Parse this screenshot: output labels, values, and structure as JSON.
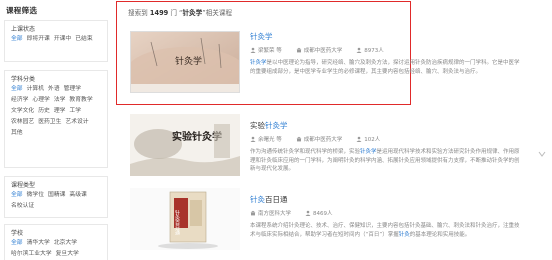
{
  "sidebar": {
    "title": "课程筛选",
    "groups": [
      {
        "label": "上课状态",
        "tags": [
          "全部",
          "即将开课",
          "开课中",
          "已结束"
        ]
      },
      {
        "label": "学科分类",
        "tags": [
          "全部",
          "计算机",
          "外语",
          "管理学",
          "经济学",
          "心理学",
          "法学",
          "教育教学",
          "文学文化",
          "历史",
          "理学",
          "工学",
          "农林园艺",
          "医药卫生",
          "艺术设计",
          "其他"
        ]
      },
      {
        "label": "课程类型",
        "tags": [
          "全部",
          "微学位",
          "国精课",
          "高级课",
          "名校认证"
        ]
      },
      {
        "label": "学校",
        "tags": [
          "全部",
          "清华大学",
          "北京大学",
          "哈尔滨工业大学",
          "复旦大学"
        ]
      }
    ]
  },
  "search": {
    "prefix": "搜索到",
    "count": "1499",
    "middle": "门 “",
    "keyword": "针灸学",
    "suffix": "”相关课程"
  },
  "courses": [
    {
      "title_hl": "针灸学",
      "title_rest": "",
      "teacher": "梁繁荣 等",
      "school": "成都中医药大学",
      "count": "8973人",
      "thumb_text": "针灸学",
      "desc_pre": "",
      "desc_hl": "针灸学",
      "desc_post": "是以中医理论为指导，研究经络、腧穴及刺灸方法，探讨运用针灸防治疾病规律的一门学科。它是中医学的重要组成部分，是中医学专业学生的必修课程，其主要内容包括经络、腧穴、刺灸法与治疗。"
    },
    {
      "title_hl": "针灸学",
      "title_pre": "实验",
      "teacher": "余曙光 等",
      "school": "成都中医药大学",
      "count": "102人",
      "thumb_text": "实验针灸学",
      "desc_pre": "作为沟通传统针灸学和现代科学的桥梁，实验",
      "desc_hl": "针灸学",
      "desc_post": "是运用现代科学技术和实验方法研究针灸作用规律、作用原理和针灸临床应用的一门学科，为阐明针灸的科学内涵、拓展针灸应用领域提供有力支撑，不断推动针灸学的创新与现代化发展。"
    },
    {
      "title_hl": "针灸",
      "title_rest": "百日通",
      "teacher": "",
      "school": "南方医科大学",
      "count": "8469人",
      "thumb_text": "针灸百日通",
      "desc_pre": "本课程系统介绍针灸理论、技术、治疗、保健知识，主要内容包括针灸基础、腧穴、刺灸法和针灸治疗，注重技术与临床实际相结合，帮助学习者在短时间内（“百日”）掌握",
      "desc_hl": "针灸",
      "desc_post": "的基本理论和实用技能。"
    }
  ],
  "colors": {
    "accent": "#2a7bd1",
    "highlight_border": "#e02a2a"
  }
}
